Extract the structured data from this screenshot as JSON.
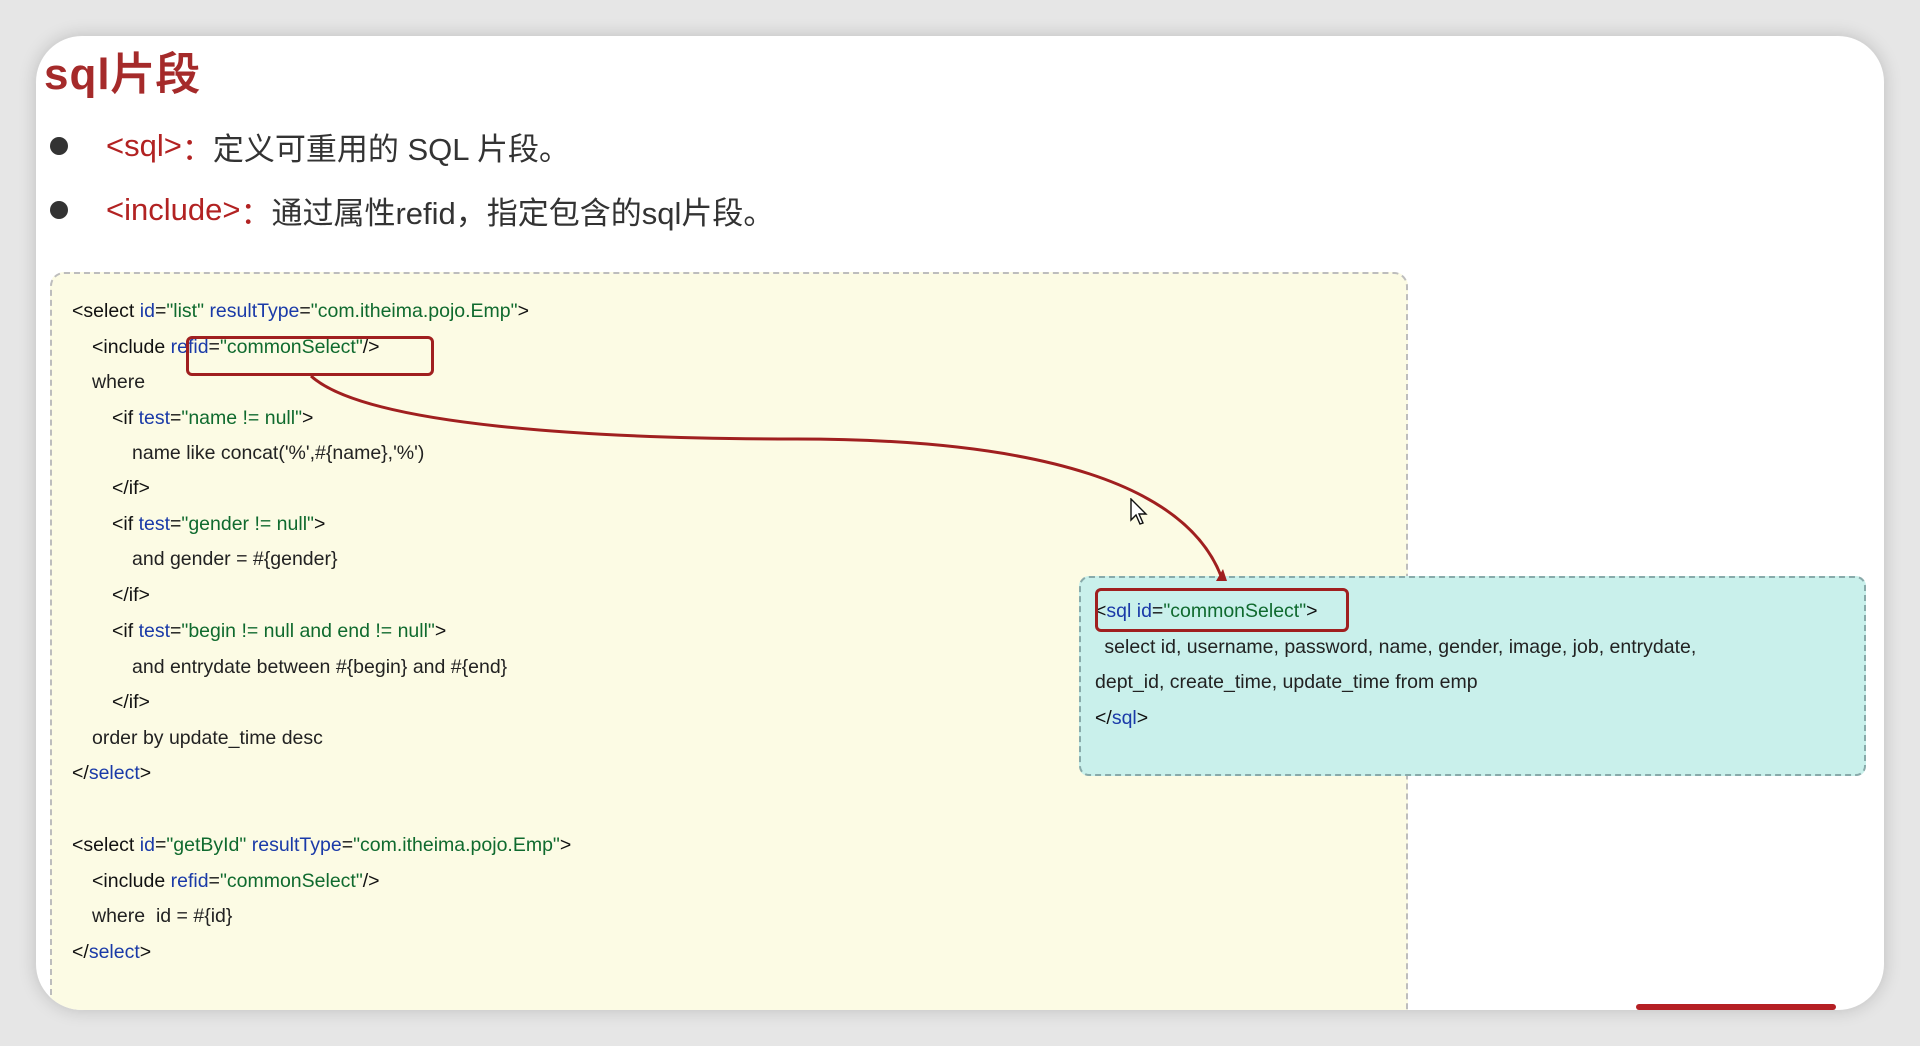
{
  "slide": {
    "title": "sql片段",
    "bullets": [
      {
        "tag": "<sql>",
        "sep": "：",
        "desc": "定义可重用的 SQL 片段。"
      },
      {
        "tag": "<include>",
        "sep": "：",
        "desc": "通过属性refid，指定包含的sql片段。"
      }
    ]
  },
  "code_block": {
    "lines": [
      [
        {
          "t": "tag",
          "v": "<select "
        },
        {
          "t": "attr",
          "v": "id"
        },
        {
          "t": "tag",
          "v": "="
        },
        {
          "t": "val",
          "v": "\"list\""
        },
        {
          "t": "tag",
          "v": " "
        },
        {
          "t": "attr",
          "v": "resultType"
        },
        {
          "t": "tag",
          "v": "="
        },
        {
          "t": "val",
          "v": "\"com.itheima.pojo.Emp\""
        },
        {
          "t": "tag",
          "v": ">"
        }
      ],
      [
        {
          "t": "tag",
          "v": "<include "
        },
        {
          "t": "attr",
          "v": "refid"
        },
        {
          "t": "tag",
          "v": "="
        },
        {
          "t": "val",
          "v": "\"commonSelect\""
        },
        {
          "t": "tag",
          "v": "/>"
        }
      ],
      [
        {
          "t": "text",
          "v": "where"
        }
      ],
      [
        {
          "t": "tag",
          "v": "<if "
        },
        {
          "t": "attr",
          "v": "test"
        },
        {
          "t": "tag",
          "v": "="
        },
        {
          "t": "val",
          "v": "\"name != null\""
        },
        {
          "t": "tag",
          "v": ">"
        }
      ],
      [
        {
          "t": "text",
          "v": "name like concat('%',#{name},'%')"
        }
      ],
      [
        {
          "t": "tag",
          "v": "</if>"
        }
      ],
      [
        {
          "t": "tag",
          "v": "<if "
        },
        {
          "t": "attr",
          "v": "test"
        },
        {
          "t": "tag",
          "v": "="
        },
        {
          "t": "val",
          "v": "\"gender != null\""
        },
        {
          "t": "tag",
          "v": ">"
        }
      ],
      [
        {
          "t": "text",
          "v": "and gender = #{gender}"
        }
      ],
      [
        {
          "t": "tag",
          "v": "</if>"
        }
      ],
      [
        {
          "t": "tag",
          "v": "<if "
        },
        {
          "t": "attr",
          "v": "test"
        },
        {
          "t": "tag",
          "v": "="
        },
        {
          "t": "val",
          "v": "\"begin != null and end != null\""
        },
        {
          "t": "tag",
          "v": ">"
        }
      ],
      [
        {
          "t": "text",
          "v": "and entrydate between #{begin} and #{end}"
        }
      ],
      [
        {
          "t": "tag",
          "v": "</if>"
        }
      ],
      [
        {
          "t": "text",
          "v": "order by update_time desc"
        }
      ],
      [
        {
          "t": "tag",
          "v": "</"
        },
        {
          "t": "attr",
          "v": "select"
        },
        {
          "t": "tag",
          "v": ">"
        }
      ],
      [
        {
          "t": "tag",
          "v": "<select "
        },
        {
          "t": "attr",
          "v": "id"
        },
        {
          "t": "tag",
          "v": "="
        },
        {
          "t": "val",
          "v": "\"getById\""
        },
        {
          "t": "tag",
          "v": " "
        },
        {
          "t": "attr",
          "v": "resultType"
        },
        {
          "t": "tag",
          "v": "="
        },
        {
          "t": "val",
          "v": "\"com.itheima.pojo.Emp\""
        },
        {
          "t": "tag",
          "v": ">"
        }
      ],
      [
        {
          "t": "tag",
          "v": "<include "
        },
        {
          "t": "attr",
          "v": "refid"
        },
        {
          "t": "tag",
          "v": "="
        },
        {
          "t": "val",
          "v": "\"commonSelect\""
        },
        {
          "t": "tag",
          "v": "/>"
        }
      ],
      [
        {
          "t": "text",
          "v": "where  id = #{id}"
        }
      ],
      [
        {
          "t": "tag",
          "v": "</"
        },
        {
          "t": "attr",
          "v": "select"
        },
        {
          "t": "tag",
          "v": ">"
        }
      ]
    ]
  },
  "sql_block": {
    "lines": [
      [
        {
          "t": "tag",
          "v": "<"
        },
        {
          "t": "attr",
          "v": "sql id"
        },
        {
          "t": "tag",
          "v": "="
        },
        {
          "t": "val",
          "v": "\"commonSelect\""
        },
        {
          "t": "tag",
          "v": ">"
        }
      ],
      [
        {
          "t": "text",
          "v": " select id, username, password, name, gender, image, job, entrydate,"
        }
      ],
      [
        {
          "t": "text",
          "v": "dept_id, create_time, update_time from emp"
        }
      ],
      [
        {
          "t": "tag",
          "v": "</"
        },
        {
          "t": "attr",
          "v": "sql"
        },
        {
          "t": "tag",
          "v": ">"
        }
      ]
    ]
  },
  "colors": {
    "title": "#a52a2a",
    "tag_accent": "#b22222",
    "highlight_border": "#a01f1f",
    "arrow": "#a01f1f",
    "code_bg": "#fcfbe4",
    "sql_bg": "#c9f0eb"
  },
  "icons": {
    "arrow": "curved-arrow-icon",
    "cursor": "mouse-cursor-icon"
  }
}
